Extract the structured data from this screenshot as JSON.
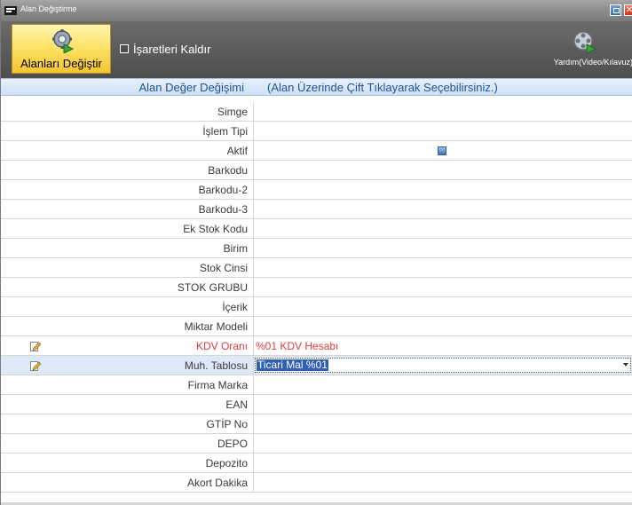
{
  "window": {
    "title": "Alan Değiştirme"
  },
  "toolbar": {
    "main_button_label": "Alanları Değiştir",
    "checkbox_label": "İşaretleri Kaldır",
    "help_label": "Yardım(Video/Kılavuz)"
  },
  "header": {
    "col1": "Alan Değer Değişimi",
    "col2": "(Alan Üzerinde Çift Tıklayarak Seçebilirsiniz.)"
  },
  "rows": [
    {
      "name": "Simge",
      "value": ""
    },
    {
      "name": "İşlem Tipi",
      "value": ""
    },
    {
      "name": "Aktif",
      "value": ""
    },
    {
      "name": "Barkodu",
      "value": ""
    },
    {
      "name": "Barkodu-2",
      "value": ""
    },
    {
      "name": "Barkodu-3",
      "value": ""
    },
    {
      "name": "Ek Stok Kodu",
      "value": ""
    },
    {
      "name": "Birim",
      "value": ""
    },
    {
      "name": "Stok Cinsi",
      "value": ""
    },
    {
      "name": "STOK GRUBU",
      "value": ""
    },
    {
      "name": "İçerik",
      "value": ""
    },
    {
      "name": "Miktar Modeli",
      "value": ""
    },
    {
      "name": "KDV Oranı",
      "value": "%01 KDV Hesabı"
    },
    {
      "name": "Muh. Tablosu",
      "value": "Ticari Mal %01"
    },
    {
      "name": "Firma Marka",
      "value": ""
    },
    {
      "name": "EAN",
      "value": ""
    },
    {
      "name": "GTİP No",
      "value": ""
    },
    {
      "name": "DEPO",
      "value": ""
    },
    {
      "name": "Depozito",
      "value": ""
    },
    {
      "name": "Akort Dakika",
      "value": ""
    }
  ],
  "colors": {
    "accent": "#24538f",
    "highlight": "#e23b3b",
    "selection": "#2f5fb3",
    "toolbar": "#5c5c5c"
  }
}
